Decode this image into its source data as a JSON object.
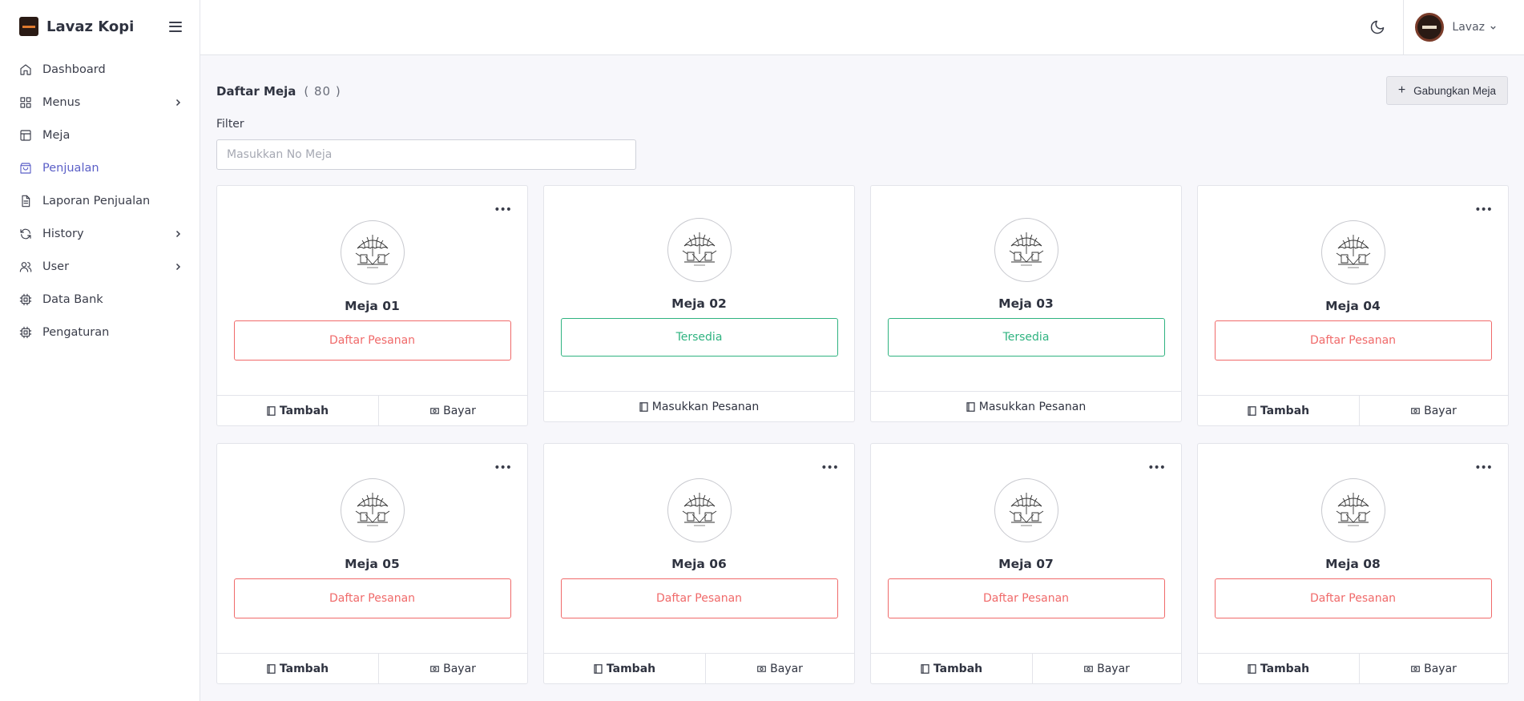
{
  "app": {
    "name": "Lavaz Kopi"
  },
  "sidebar": {
    "items": [
      {
        "label": "Dashboard",
        "icon": "home-icon",
        "has_submenu": false,
        "active": false
      },
      {
        "label": "Menus",
        "icon": "grid-icon",
        "has_submenu": true,
        "active": false
      },
      {
        "label": "Meja",
        "icon": "table-icon",
        "has_submenu": false,
        "active": false
      },
      {
        "label": "Penjualan",
        "icon": "shopping-bag-icon",
        "has_submenu": false,
        "active": true
      },
      {
        "label": "Laporan Penjualan",
        "icon": "document-icon",
        "has_submenu": false,
        "active": false
      },
      {
        "label": "History",
        "icon": "refresh-icon",
        "has_submenu": true,
        "active": false
      },
      {
        "label": "User",
        "icon": "users-icon",
        "has_submenu": true,
        "active": false
      },
      {
        "label": "Data Bank",
        "icon": "chip-icon",
        "has_submenu": false,
        "active": false
      },
      {
        "label": "Pengaturan",
        "icon": "chip-icon",
        "has_submenu": false,
        "active": false
      }
    ]
  },
  "topbar": {
    "user_name": "Lavaz"
  },
  "page": {
    "title": "Daftar Meja",
    "count": "( 80 )",
    "merge_button": "Gabungkan Meja",
    "filter_label": "Filter",
    "filter_placeholder": "Masukkan No Meja",
    "filter_value": ""
  },
  "labels": {
    "busy": "Daftar Pesanan",
    "free": "Tersedia",
    "add": "Tambah",
    "pay": "Bayar",
    "enter_order": "Masukkan Pesanan"
  },
  "tables": [
    {
      "name": "Meja 01",
      "status": "busy"
    },
    {
      "name": "Meja 02",
      "status": "free"
    },
    {
      "name": "Meja 03",
      "status": "free"
    },
    {
      "name": "Meja 04",
      "status": "busy"
    },
    {
      "name": "Meja 05",
      "status": "busy"
    },
    {
      "name": "Meja 06",
      "status": "busy"
    },
    {
      "name": "Meja 07",
      "status": "busy"
    },
    {
      "name": "Meja 08",
      "status": "busy"
    }
  ],
  "colors": {
    "accent": "#5b5fc7",
    "busy": "#f06a6a",
    "free": "#2fb380"
  }
}
